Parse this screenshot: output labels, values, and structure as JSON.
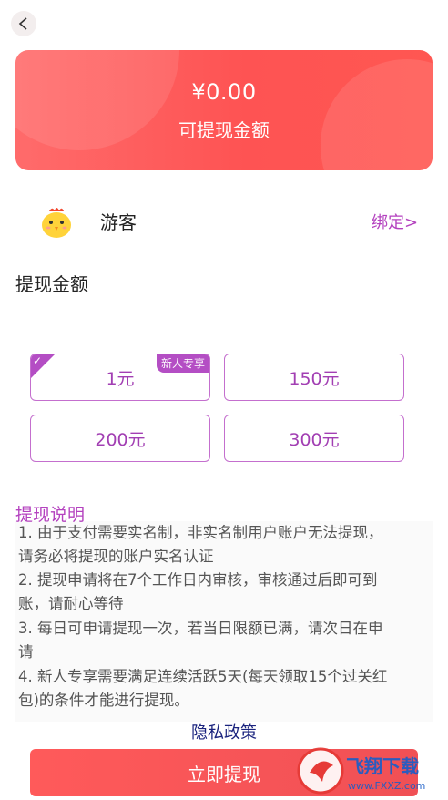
{
  "balance": {
    "amount": "¥0.00",
    "label": "可提现金额"
  },
  "user": {
    "name": "游客",
    "bind_link": "绑定>",
    "avatar_icon": "chick-avatar-icon"
  },
  "withdraw": {
    "section_title": "提现金额",
    "options": [
      {
        "label": "1元",
        "badge": "新人专享",
        "selected": true
      },
      {
        "label": "150元"
      },
      {
        "label": "200元"
      },
      {
        "label": "300元"
      }
    ],
    "button_label": "立即提现"
  },
  "notes": {
    "title": "提现说明",
    "lines": [
      "1. 由于支付需要实名制，非实名制用户账户无法提现，",
      "请务必将提现的账户实名认证",
      "2. 提现申请将在7个工作日内审核，审核通过后即可到",
      "账，请耐心等待",
      "3. 每日可申请提现一次，若当日限额已满，请次日在申",
      "请",
      "4. 新人专享需要满足连续活跃5天(每天领取15个过关红",
      "包)的条件才能进行提现。"
    ]
  },
  "privacy_link": "隐私政策",
  "watermark": {
    "brand": "飞翔下载",
    "url": "www.FXXZ.com"
  },
  "colors": {
    "card_red": "#fe5353",
    "accent_purple": "#b442bf",
    "link_blue": "#1a237e"
  }
}
